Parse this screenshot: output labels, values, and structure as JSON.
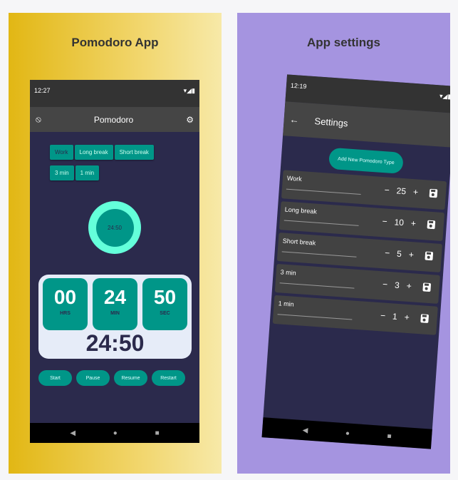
{
  "left": {
    "title": "Pomodoro App",
    "status_time": "12:27",
    "status_icons": "▾◢▮",
    "app_title": "Pomodoro",
    "chips": [
      "Work",
      "Long break",
      "Short break",
      "3 min",
      "1 min"
    ],
    "ring_time": "24:50",
    "hours": "00",
    "hours_label": "HRS",
    "minutes": "24",
    "minutes_label": "MIN",
    "seconds": "50",
    "seconds_label": "SEC",
    "big_time": "24:50",
    "buttons": [
      "Start",
      "Pause",
      "Resume",
      "Restart"
    ]
  },
  "right": {
    "title": "App settings",
    "status_time": "12:19",
    "status_icons": "▾◢▮",
    "app_title": "Settings",
    "add_button": "Add New Pomodoro Type",
    "rows": [
      {
        "label": "Work",
        "value": "25"
      },
      {
        "label": "Long break",
        "value": "10"
      },
      {
        "label": "Short break",
        "value": "5"
      },
      {
        "label": "3 min",
        "value": "3"
      },
      {
        "label": "1 min",
        "value": "1"
      }
    ]
  },
  "nav": {
    "back": "◀",
    "home": "●",
    "recent": "■"
  }
}
